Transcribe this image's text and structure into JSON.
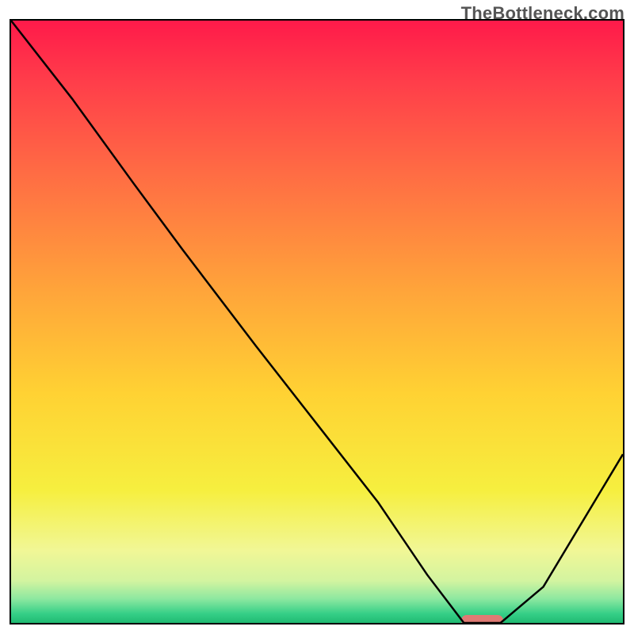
{
  "watermark": "TheBottleneck.com",
  "chart_data": {
    "type": "line",
    "title": "",
    "xlabel": "",
    "ylabel": "",
    "xlim": [
      0,
      100
    ],
    "ylim": [
      0,
      100
    ],
    "series": [
      {
        "name": "bottleneck-curve",
        "x": [
          0,
          10,
          20,
          28,
          40,
          50,
          60,
          68,
          74,
          80,
          87,
          100
        ],
        "y": [
          100,
          87,
          73,
          62,
          46,
          33,
          20,
          8,
          0,
          0,
          6,
          28
        ],
        "color": "#000000"
      }
    ],
    "marker": {
      "name": "optimal-range",
      "x_start": 74,
      "x_end": 80,
      "y": 0,
      "color": "#e07a74"
    },
    "background_gradient_stops": [
      {
        "pos": 0.0,
        "color": "#ff1a4a"
      },
      {
        "pos": 0.1,
        "color": "#ff3d4a"
      },
      {
        "pos": 0.25,
        "color": "#ff6b44"
      },
      {
        "pos": 0.45,
        "color": "#ffa53a"
      },
      {
        "pos": 0.62,
        "color": "#ffd233"
      },
      {
        "pos": 0.78,
        "color": "#f6ef3f"
      },
      {
        "pos": 0.88,
        "color": "#f1f796"
      },
      {
        "pos": 0.93,
        "color": "#d3f4a0"
      },
      {
        "pos": 0.96,
        "color": "#8de8a0"
      },
      {
        "pos": 0.985,
        "color": "#35cf87"
      },
      {
        "pos": 1.0,
        "color": "#1fb971"
      }
    ]
  }
}
